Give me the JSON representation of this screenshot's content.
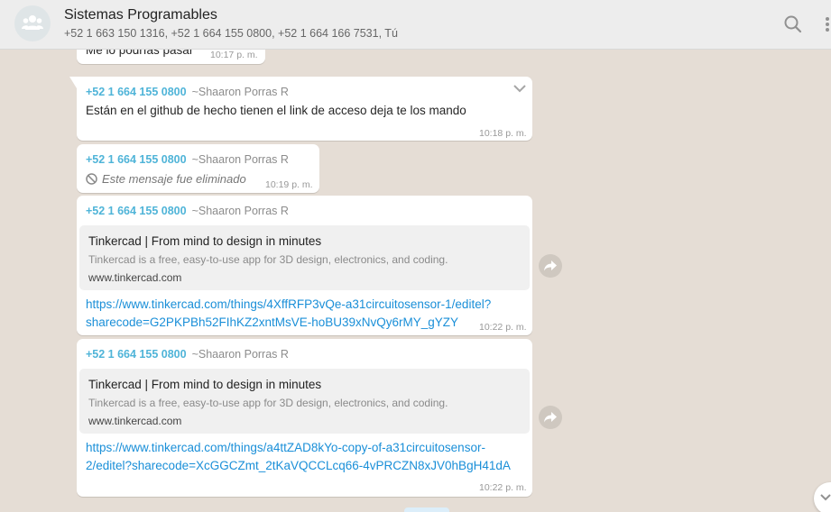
{
  "header": {
    "title": "Sistemas Programables",
    "participants": "+52 1 663 150 1316, +52 1 664 155 0800, +52 1 664 166 7531, Tú",
    "search_icon": "search-icon",
    "menu_icon": "kebab-menu-icon"
  },
  "messages": [
    {
      "text": "Me lo podrías pasar",
      "time": "10:17 p. m."
    },
    {
      "sender_number": "+52 1 664 155 0800",
      "sender_alias": "~Shaaron Porras R",
      "text": "Están en el github de hecho tienen el link de acceso deja te los mando",
      "time": "10:18 p. m."
    },
    {
      "sender_number": "+52 1 664 155 0800",
      "sender_alias": "~Shaaron Porras R",
      "deleted_text": "Este mensaje fue eliminado",
      "time": "10:19 p. m."
    },
    {
      "sender_number": "+52 1 664 155 0800",
      "sender_alias": "~Shaaron Porras R",
      "preview": {
        "title": "Tinkercad | From mind to design in minutes",
        "description": "Tinkercad is a free, easy-to-use app for 3D design, electronics, and coding.",
        "domain": "www.tinkercad.com"
      },
      "link_line1": "https://www.tinkercad.com/things/4XffRFP3vQe-a31circuitosensor-1/editel?",
      "link_line2": "sharecode=G2PKPBh52FIhKZ2xntMsVE-hoBU39xNvQy6rMY_gYZY",
      "time": "10:22 p. m."
    },
    {
      "sender_number": "+52 1 664 155 0800",
      "sender_alias": "~Shaaron Porras R",
      "preview": {
        "title": "Tinkercad | From mind to design in minutes",
        "description": "Tinkercad is a free, easy-to-use app for 3D design, electronics, and coding.",
        "domain": "www.tinkercad.com"
      },
      "link_line1": "https://www.tinkercad.com/things/a4ttZAD8kYo-copy-of-a31circuitosensor-",
      "link_line2": "2/editel?sharecode=XcGGCZmt_2tKaVQCCLcq66-4vPRCZN8xJV0hBgH41dA",
      "time": "10:22 p. m."
    }
  ],
  "colors": {
    "chat_bg": "#e5ddd5",
    "header_bg": "#ededed",
    "sender": "#4fb4d8",
    "link": "#1a8fd8"
  }
}
